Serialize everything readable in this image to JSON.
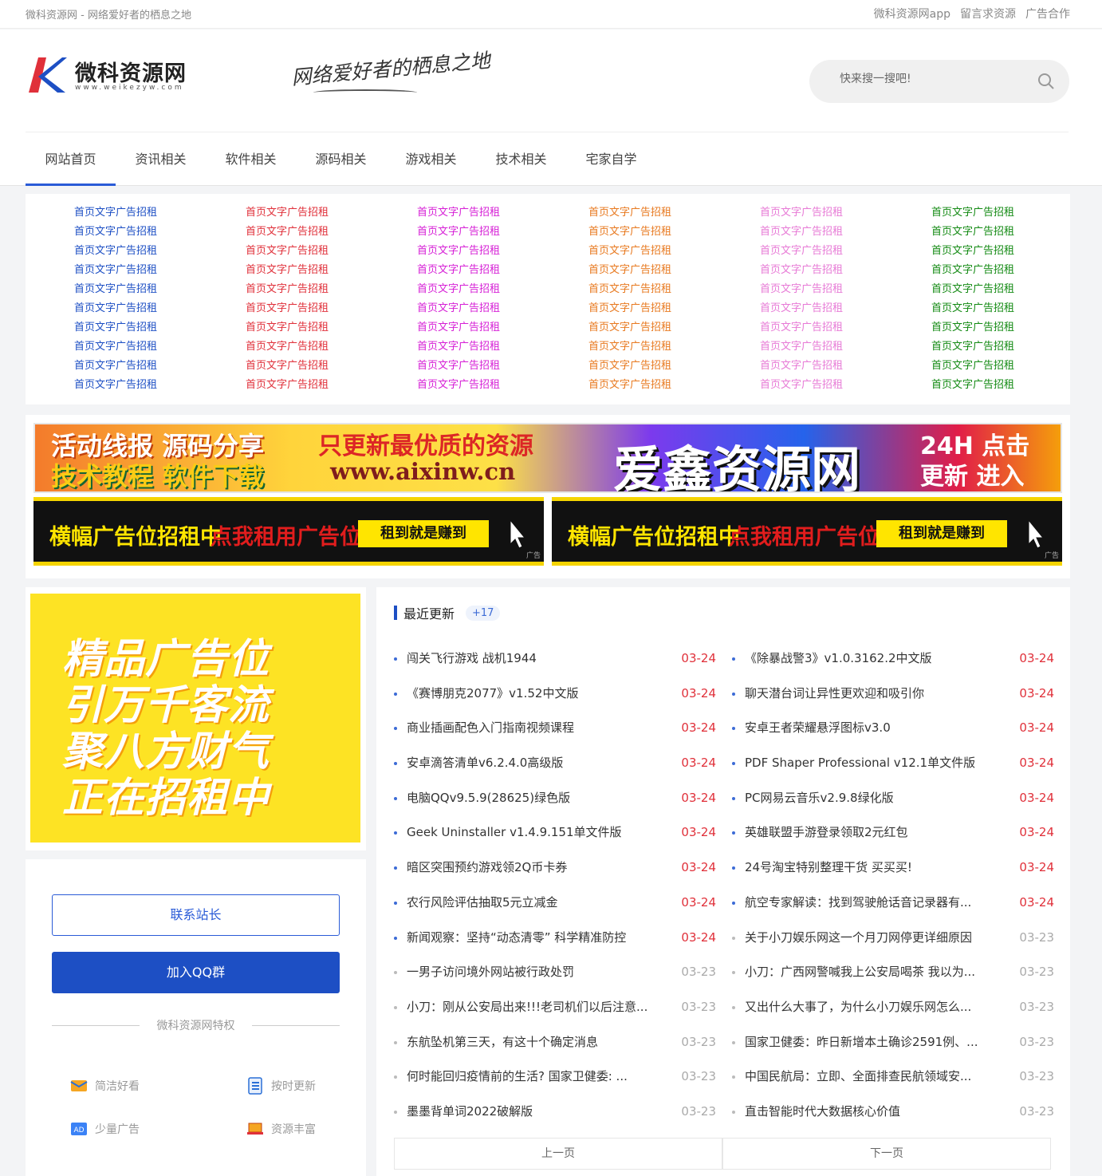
{
  "topbar": {
    "slogan": "微科资源网 - 网络爱好者的栖息之地",
    "links": [
      "微科资源网app",
      "留言求资源",
      "广告合作"
    ]
  },
  "header": {
    "logo_text": "微科资源网",
    "logo_sub": "www.weikezyw.com",
    "slogan_script": "网络爱好者的栖息之地",
    "search_placeholder": "快来搜一搜吧!"
  },
  "nav": [
    "网站首页",
    "资讯相关",
    "软件相关",
    "源码相关",
    "游戏相关",
    "技术相关",
    "宅家自学"
  ],
  "text_ads": {
    "label": "首页文字广告招租",
    "rows_per_column": 10,
    "colors": [
      "#1d4fc4",
      "#e0303a",
      "#d61fd6",
      "#e8791f",
      "#e77ad6",
      "#138a13"
    ]
  },
  "banner_big": {
    "left_top": "活动线报  源码分享",
    "left_bottom": "技术教程  软件下载",
    "mid_top": "只更新最优质的资源",
    "mid_bottom": "www.aixinw.cn",
    "brand": "爱鑫资源网",
    "right_top": "24H 点击",
    "right_bottom": "更新 进入"
  },
  "banner_small": {
    "title": "横幅广告位招租中",
    "cta": "点我租用广告位",
    "button": "租到就是赚到",
    "tag": "广告"
  },
  "side_ad": {
    "lines": [
      "精品广告位",
      "引万千客流",
      "聚八方财气",
      "正在招租中"
    ]
  },
  "side_box": {
    "contact": "联系站长",
    "join_qq": "加入QQ群",
    "feature_title": "微科资源网特权",
    "features": [
      {
        "icon": "envelope-icon",
        "label": "简洁好看"
      },
      {
        "icon": "list-icon",
        "label": "按时更新"
      },
      {
        "icon": "ad-icon",
        "label": "少量广告"
      },
      {
        "icon": "laptop-icon",
        "label": "资源丰富"
      }
    ]
  },
  "recent": {
    "title": "最近更新",
    "badge": "+17",
    "left": [
      {
        "title": "闯关飞行游戏 战机1944",
        "date": "03-24"
      },
      {
        "title": "《赛博朋克2077》v1.52中文版",
        "date": "03-24"
      },
      {
        "title": "商业插画配色入门指南视频课程",
        "date": "03-24"
      },
      {
        "title": "安卓滴答清单v6.2.4.0高级版",
        "date": "03-24"
      },
      {
        "title": "电脑QQv9.5.9(28625)绿色版",
        "date": "03-24"
      },
      {
        "title": "Geek Uninstaller v1.4.9.151单文件版",
        "date": "03-24"
      },
      {
        "title": "暗区突围预约游戏领2Q币卡券",
        "date": "03-24"
      },
      {
        "title": "农行风险评估抽取5元立减金",
        "date": "03-24"
      },
      {
        "title": "新闻观察：坚持“动态清零” 科学精准防控",
        "date": "03-24"
      },
      {
        "title": "一男子访问境外网站被行政处罚",
        "date": "03-23"
      },
      {
        "title": "小刀：刚从公安局出来!!!老司机们以后注意...",
        "date": "03-23"
      },
      {
        "title": "东航坠机第三天，有这十个确定消息",
        "date": "03-23"
      },
      {
        "title": "何时能回归疫情前的生活? 国家卫健委: ...",
        "date": "03-23"
      },
      {
        "title": "墨墨背单词2022破解版",
        "date": "03-23"
      }
    ],
    "right": [
      {
        "title": "《除暴战警3》v1.0.3162.2中文版",
        "date": "03-24"
      },
      {
        "title": "聊天潜台词让异性更欢迎和吸引你",
        "date": "03-24"
      },
      {
        "title": "安卓王者荣耀悬浮图标v3.0",
        "date": "03-24"
      },
      {
        "title": "PDF Shaper Professional v12.1单文件版",
        "date": "03-24"
      },
      {
        "title": "PC网易云音乐v2.9.8绿化版",
        "date": "03-24"
      },
      {
        "title": "英雄联盟手游登录领取2元红包",
        "date": "03-24"
      },
      {
        "title": "24号淘宝特别整理干货 买买买!",
        "date": "03-24"
      },
      {
        "title": "航空专家解读：找到驾驶舱话音记录器有...",
        "date": "03-24"
      },
      {
        "title": "关于小刀娱乐网这一个月刀网停更详细原因",
        "date": "03-23"
      },
      {
        "title": "小刀：广西网警喊我上公安局喝茶 我以为...",
        "date": "03-23"
      },
      {
        "title": "又出什么大事了，为什么小刀娱乐网怎么...",
        "date": "03-23"
      },
      {
        "title": "国家卫健委：昨日新增本土确诊2591例、...",
        "date": "03-23"
      },
      {
        "title": "中国民航局：立即、全面排查民航领域安...",
        "date": "03-23"
      },
      {
        "title": "直击智能时代大数据核心价值",
        "date": "03-23"
      }
    ],
    "prev": "上一页",
    "next": "下一页"
  }
}
